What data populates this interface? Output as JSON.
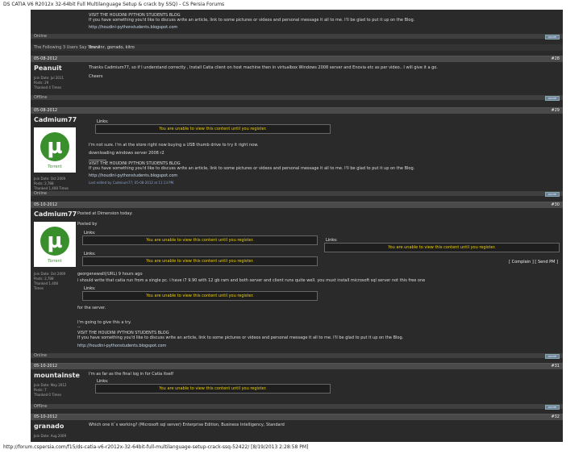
{
  "page_title": "DS CATIA V6 R2012x 32-64bit Full Multilanguage Setup & crack by SSQ) - CS Persia Forums",
  "footer_url": "http://forum.cspersia.com/f15/ds-catia-v6-r2012x-32-64bit-full-multilanguage-setup-crack-ssq-52422/ [8/19/2013 2:28:58 PM]",
  "signature": {
    "line1": "VISIT THE HOUDINI PYTHON STUDENTS BLOG",
    "line2": "If you have something you'd like to discuss write an article, link to some pictures or videos and personal message it all to me. I'll be glad to put it up on the Blog.",
    "link": "http://houdini-pythonstudents.blogspot.com"
  },
  "status_online": "Online",
  "status_offline": "Offline",
  "quote_label": "QUOTE",
  "thanks": {
    "label": "The Following 3 Users Say Thank",
    "names": "dmrvlnr, gorrado, kitro"
  },
  "links_label": "Links:",
  "restricted_text": "You are unable to view this content until you register.",
  "posts": [
    {
      "date": "05-08-2012",
      "number": "#28",
      "username": "Peanuit",
      "info": [
        "Join Date: Jul 2011",
        "Posts: 29",
        "Thanked 4 Times"
      ],
      "message": "Thanks Cadmium77, so if I understand correctly , Install Catia client on host machine then in virtualbox Windows 2008 server and Enovia etc as per video.. I will give it a go.",
      "message2": "Cheers"
    },
    {
      "date": "05-08-2012",
      "number": "#29",
      "username": "Cadmium77",
      "avatar_caption": "Torrent",
      "info": [
        "Join Date: Oct 2009",
        "Posts: 2,788",
        "Thanked 1,408 Times"
      ],
      "message": "I'm not sure. I'm at the store right now buying a USB thumb drive to try it right now.",
      "message2": "downloading windows server 2008 r2",
      "edit": "Last edited by Cadmium77; 05-08-2012 at 11:13 PM."
    },
    {
      "date": "05-10-2012",
      "number": "#30",
      "username": "Cadmium77",
      "avatar_caption": "Torrent",
      "info": [
        "Join Date: Oct 2009",
        "Posts: 2,788",
        "Thanked 1,408",
        "Times"
      ],
      "posted": "Posted at Dimension today:",
      "posted_by": "Posted by",
      "complain": "[ Complain ] [ Send PM ]",
      "user_line": "georgenewall(/URL) 9 hours ago",
      "message": "i should write that catia run from a single pc. i have i7 9.90 with 12 gb ram and both server and client runs quite well. you must install microsoft sql server not this free one",
      "message2": "for the server.",
      "message3": "I'm going to give this a try.",
      "message4": "--"
    },
    {
      "date": "05-10-2012",
      "number": "#31",
      "username": "mountainste",
      "info": [
        "Join Date: May 2012",
        "Posts: 7",
        "Thanked 0 Times"
      ],
      "message": "I'm as far as the final log in for Catia itself"
    },
    {
      "date": "05-10-2012",
      "number": "#32",
      "username": "granado",
      "info": [
        "Join Date: Aug 2009"
      ],
      "message": "Which one it`s working? (Microsoft sql server) Enterprise Edition, Business Intelligency, Standard"
    }
  ]
}
